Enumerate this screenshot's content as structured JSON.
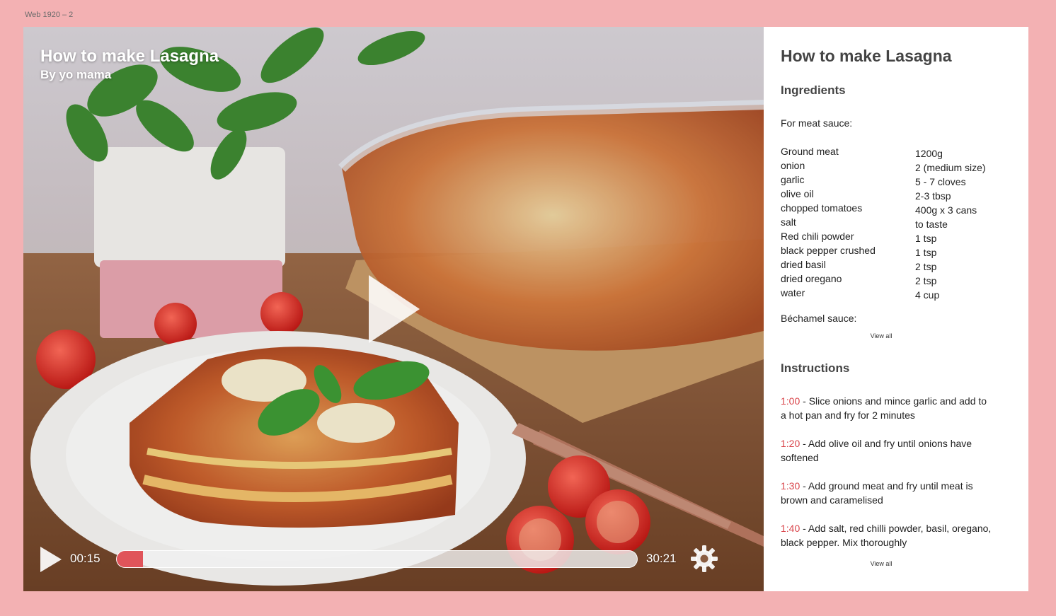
{
  "frame": {
    "label": "Web 1920 – 2"
  },
  "video": {
    "title": "How to make Lasagna",
    "author": "By yo mama",
    "current_time": "00:15",
    "total_time": "30:21",
    "progress_fraction": 0.05,
    "accent_color": "#e0545a"
  },
  "recipe": {
    "title": "How to make Lasagna",
    "ingredients_heading": "Ingredients",
    "meat_sauce_label": "For meat sauce:",
    "ingredients": [
      {
        "name": "Ground meat",
        "qty": "1200g"
      },
      {
        "name": "onion",
        "qty": "2 (medium size)"
      },
      {
        "name": "garlic",
        "qty": "5 - 7 cloves"
      },
      {
        "name": "olive oil",
        "qty": "2-3 tbsp"
      },
      {
        "name": "chopped tomatoes",
        "qty": "400g x 3 cans"
      },
      {
        "name": "salt",
        "qty": "to taste"
      },
      {
        "name": "Red chili powder",
        "qty": "1 tsp"
      },
      {
        "name": "black pepper crushed",
        "qty": "1 tsp"
      },
      {
        "name": "dried basil",
        "qty": "2 tsp"
      },
      {
        "name": "dried oregano",
        "qty": "2 tsp"
      },
      {
        "name": "water",
        "qty": "4 cup"
      }
    ],
    "bechamel_label": "Béchamel sauce:",
    "view_all_ingredients": "View all",
    "instructions_heading": "Instructions",
    "steps": [
      {
        "time": "1:00",
        "text": " - Slice onions and mince garlic and add to a hot pan and fry for 2 minutes"
      },
      {
        "time": "1:20",
        "text": " - Add olive oil and fry until onions have softened"
      },
      {
        "time": "1:30",
        "text": " - Add ground meat and fry until meat is brown and caramelised"
      },
      {
        "time": "1:40",
        "text": " - Add salt, red chilli powder, basil, oregano,  black pepper. Mix thoroughly"
      }
    ],
    "view_all_instructions": "View all",
    "step_time_color": "#d9454b"
  },
  "icons": {
    "big_play": "play-icon",
    "control_play": "play-icon",
    "settings": "gear-icon"
  }
}
